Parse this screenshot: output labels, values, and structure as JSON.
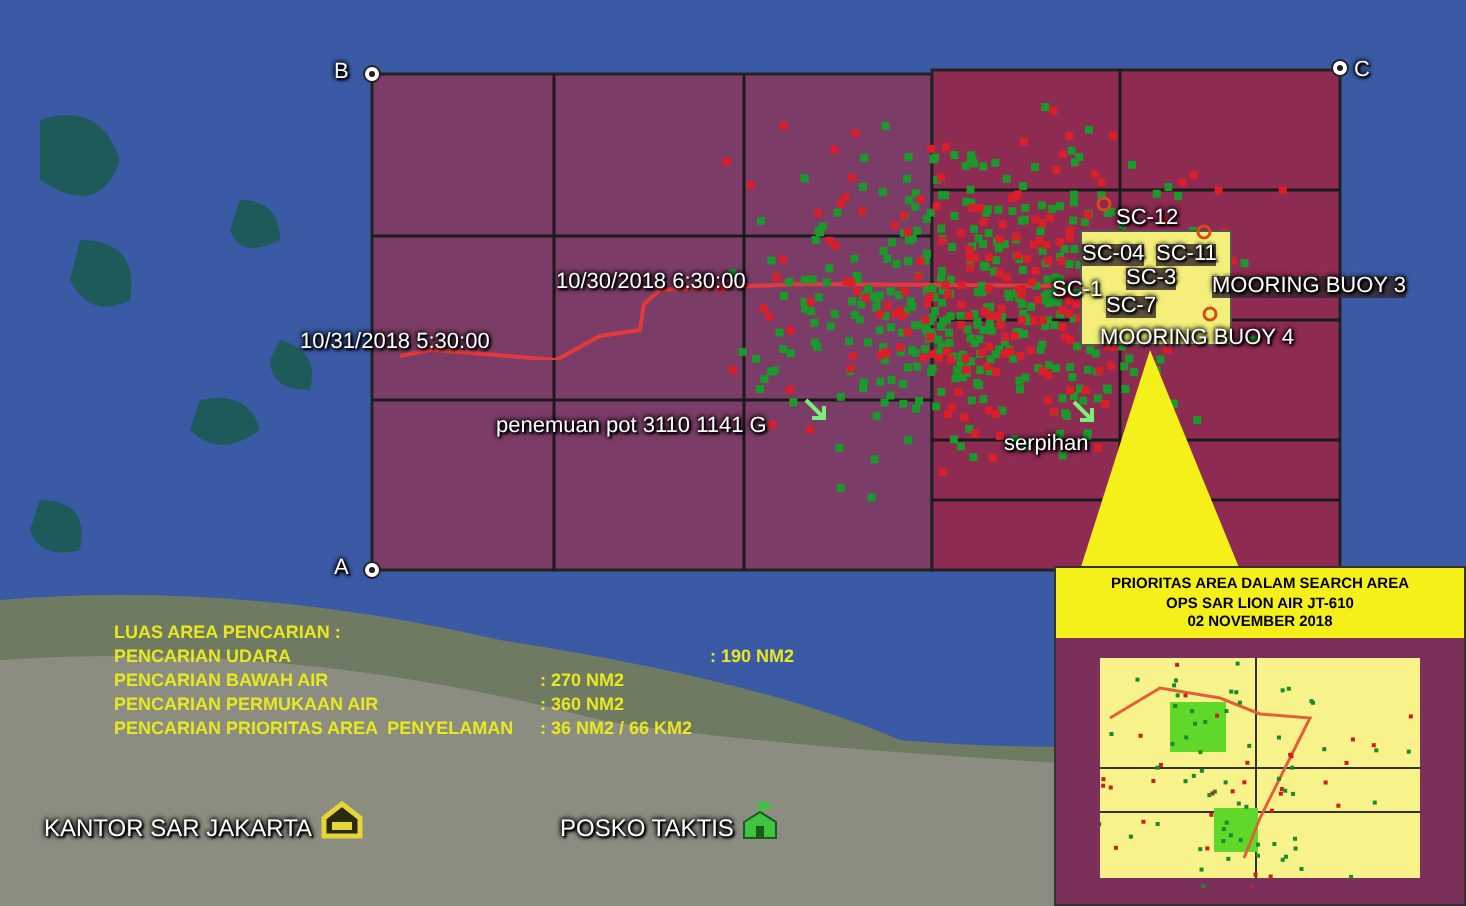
{
  "corners": [
    {
      "label": "B"
    },
    {
      "label": "C"
    },
    {
      "label": "A"
    }
  ],
  "map_labels": [
    {
      "text": "10/30/2018 6:30:00"
    },
    {
      "text": "10/31/2018 5:30:00"
    },
    {
      "text": "penemuan pot 3110 1141 G"
    },
    {
      "text": "serpihan"
    },
    {
      "text": "SC-12"
    },
    {
      "text": "SC-04"
    },
    {
      "text": "SC-11"
    },
    {
      "text": "SC-1"
    },
    {
      "text": "SC-3"
    },
    {
      "text": "SC-7"
    },
    {
      "text": "MOORING BUOY 3"
    },
    {
      "text": "MOORING BUOY 4"
    }
  ],
  "places": [
    {
      "text": "KANTOR SAR JAKARTA",
      "kind": "office"
    },
    {
      "text": "POSKO TAKTIS",
      "kind": "post"
    }
  ],
  "summary": {
    "title": "LUAS AREA PENCARIAN :",
    "rows": [
      {
        "label": "PENCARIAN UDARA",
        "value": ": 190 NM2"
      },
      {
        "label": "PENCARIAN BAWAH AIR",
        "value": ": 270 NM2"
      },
      {
        "label": "PENCARIAN PERMUKAAN AIR",
        "value": ": 360 NM2"
      },
      {
        "label": "PENCARIAN PRIORITAS AREA  PENYELAMAN",
        "value": ": 36 NM2 / 66 KM2"
      }
    ]
  },
  "inset": {
    "title_lines": [
      "PRIORITAS AREA DALAM SEARCH AREA",
      "OPS SAR LION AIR JT-610",
      "02 NOVEMBER 2018"
    ]
  }
}
